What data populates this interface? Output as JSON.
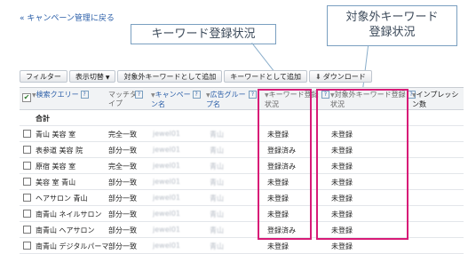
{
  "back_link": "« キャンペーン管理に戻る",
  "callouts": {
    "keyword_status": "キーワード登録状況",
    "excluded_line1": "対象外キーワード",
    "excluded_line2": "登録状況"
  },
  "toolbar": {
    "filter": "フィルター",
    "view_toggle": "表示切替",
    "add_excluded": "対象外キーワードとして追加",
    "add_keyword": "キーワードとして追加",
    "download": "ダウンロード"
  },
  "columns": {
    "query": "検索クエリー",
    "match_type_1": "マッチタ",
    "match_type_2": "イプ",
    "campaign_1": "キャンペー",
    "campaign_2": "ン名",
    "adgroup_1": "広告グルー",
    "adgroup_2": "プ名",
    "kw_status_1": "キーワード登録",
    "kw_status_2": "状況",
    "excluded_status_1": "対象外キーワード登録",
    "excluded_status_2": "状況",
    "impressions_1": "インプレッシ",
    "impressions_2": "ン数"
  },
  "help_mark": "?",
  "total_label": "合計",
  "blur_text": {
    "campaign": "jewel01",
    "adgroup": "青山"
  },
  "rows": [
    {
      "query": "青山 美容 室",
      "match": "完全一致",
      "kw": "未登録",
      "ex": "未登録"
    },
    {
      "query": "表参道 美容 院",
      "match": "部分一致",
      "kw": "登録済み",
      "ex": "未登録"
    },
    {
      "query": "原宿 美容 室",
      "match": "完全一致",
      "kw": "登録済み",
      "ex": "未登録"
    },
    {
      "query": "美容 室 青山",
      "match": "部分一致",
      "kw": "未登録",
      "ex": "未登録"
    },
    {
      "query": "ヘアサロン 青山",
      "match": "部分一致",
      "kw": "未登録",
      "ex": "未登録"
    },
    {
      "query": "南青山 ネイルサロン",
      "match": "部分一致",
      "kw": "未登録",
      "ex": "未登録"
    },
    {
      "query": "南青山 ヘアサロン",
      "match": "部分一致",
      "kw": "登録済み",
      "ex": "未登録"
    },
    {
      "query": "南青山 デジタルパーマ",
      "match": "部分一致",
      "kw": "未登録",
      "ex": "未登録"
    }
  ],
  "colors": {
    "highlight": "#d81b77",
    "link": "#2a5ea8",
    "callout_border": "#7a9fc0"
  }
}
